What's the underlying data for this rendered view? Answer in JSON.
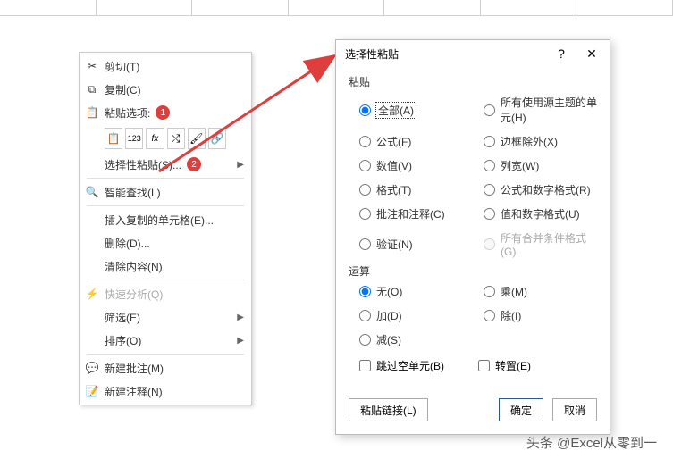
{
  "menu": {
    "cut": "剪切(T)",
    "copy": "复制(C)",
    "paste_options_label": "粘贴选项:",
    "paste_special": "选择性粘贴(S)...",
    "smart_lookup": "智能查找(L)",
    "insert_copied": "插入复制的单元格(E)...",
    "delete": "删除(D)...",
    "clear_contents": "清除内容(N)",
    "quick_analysis": "快速分析(Q)",
    "filter": "筛选(E)",
    "sort": "排序(O)",
    "new_comment": "新建批注(M)",
    "new_note": "新建注释(N)",
    "badge1": "1",
    "badge2": "2"
  },
  "dialog": {
    "title": "选择性粘贴",
    "help": "?",
    "close": "✕",
    "paste_label": "粘贴",
    "operation_label": "运算",
    "radios_paste": {
      "all": "全部(A)",
      "all_source_theme": "所有使用源主题的单元(H)",
      "formulas": "公式(F)",
      "borders_except": "边框除外(X)",
      "values": "数值(V)",
      "col_widths": "列宽(W)",
      "formats": "格式(T)",
      "formulas_num_fmt": "公式和数字格式(R)",
      "comments": "批注和注释(C)",
      "values_num_fmt": "值和数字格式(U)",
      "validation": "验证(N)",
      "all_merge_cond": "所有合并条件格式(G)"
    },
    "radios_op": {
      "none": "无(O)",
      "multiply": "乘(M)",
      "add": "加(D)",
      "divide": "除(I)",
      "subtract": "减(S)"
    },
    "checks": {
      "skip_blanks": "跳过空单元(B)",
      "transpose": "转置(E)"
    },
    "btn_paste_link": "粘贴链接(L)",
    "btn_ok": "确定",
    "btn_cancel": "取消"
  },
  "watermark": "头条 @Excel从零到一"
}
